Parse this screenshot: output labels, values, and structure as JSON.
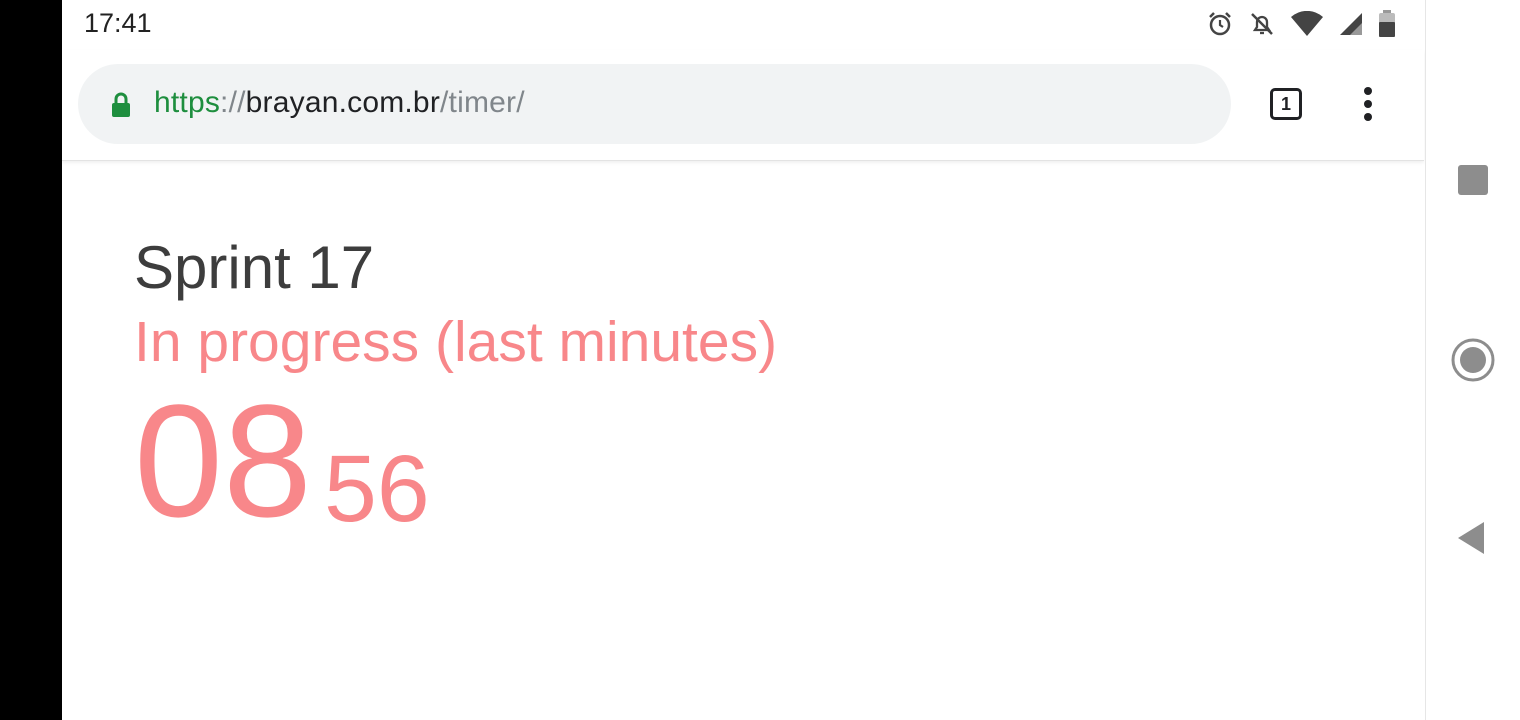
{
  "status_bar": {
    "time": "17:41",
    "icons": [
      "alarm-icon",
      "notifications-off-icon",
      "wifi-icon",
      "signal-icon",
      "battery-icon"
    ]
  },
  "browser": {
    "url_scheme": "https",
    "url_sep": "://",
    "url_host": "brayan.com.br",
    "url_path": "/timer/",
    "tab_count": "1",
    "lock_icon": "lock-icon",
    "menu_icon": "more-vert-icon"
  },
  "page": {
    "title": "Sprint 17",
    "status": "In progress (last minutes)",
    "timer_minutes": "08",
    "timer_seconds": "56"
  },
  "colors": {
    "accent": "#f8878a",
    "secure_green": "#1e8e3e",
    "title": "#3d3d3d"
  },
  "nav_bar": {
    "icons": [
      "recent-apps-icon",
      "home-icon",
      "back-icon"
    ]
  }
}
